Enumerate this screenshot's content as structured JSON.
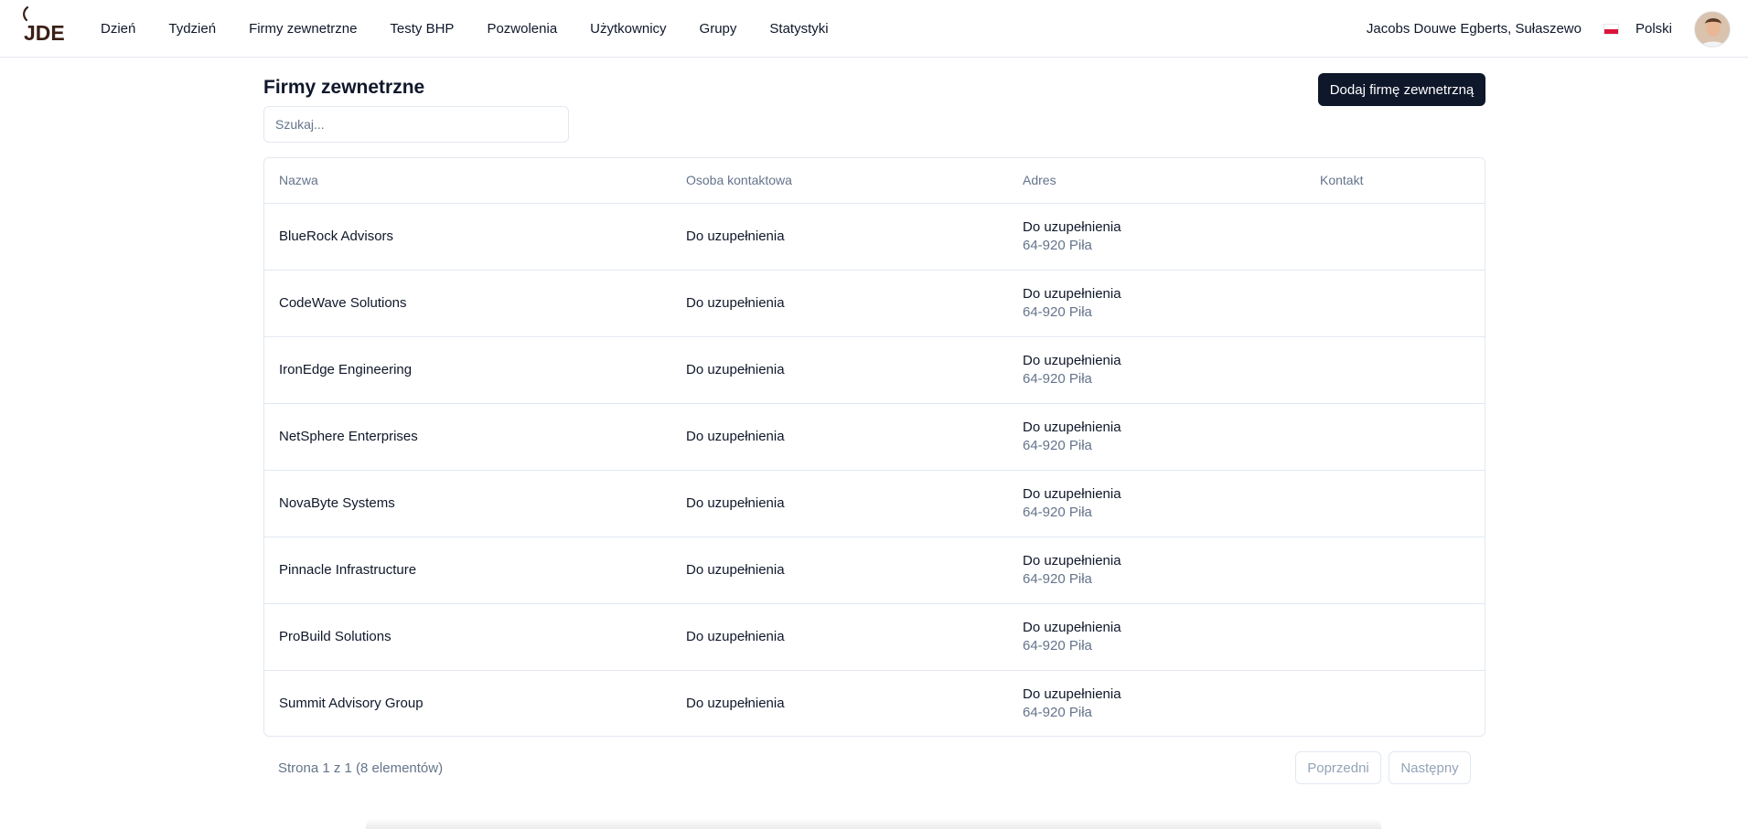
{
  "nav": {
    "logo_text": "JDE",
    "items": [
      {
        "label": "Dzień"
      },
      {
        "label": "Tydzień"
      },
      {
        "label": "Firmy zewnetrzne"
      },
      {
        "label": "Testy BHP"
      },
      {
        "label": "Pozwolenia"
      },
      {
        "label": "Użytkownicy"
      },
      {
        "label": "Grupy"
      },
      {
        "label": "Statystyki"
      }
    ],
    "company": "Jacobs Douwe Egberts, Sułaszewo",
    "language": "Polski",
    "flag_icon": "poland-flag-icon",
    "avatar_icon": "user-avatar"
  },
  "page": {
    "title": "Firmy zewnetrzne",
    "add_button": "Dodaj firmę zewnetrzną",
    "search_placeholder": "Szukaj..."
  },
  "table": {
    "columns": [
      "Nazwa",
      "Osoba kontaktowa",
      "Adres",
      "Kontakt"
    ],
    "rows": [
      {
        "name": "BlueRock Advisors",
        "contact_person": "Do uzupełnienia",
        "address_line1": "Do uzupełnienia",
        "address_line2": "64-920 Piła",
        "contact": ""
      },
      {
        "name": "CodeWave Solutions",
        "contact_person": "Do uzupełnienia",
        "address_line1": "Do uzupełnienia",
        "address_line2": "64-920 Piła",
        "contact": ""
      },
      {
        "name": "IronEdge Engineering",
        "contact_person": "Do uzupełnienia",
        "address_line1": "Do uzupełnienia",
        "address_line2": "64-920 Piła",
        "contact": ""
      },
      {
        "name": "NetSphere Enterprises",
        "contact_person": "Do uzupełnienia",
        "address_line1": "Do uzupełnienia",
        "address_line2": "64-920 Piła",
        "contact": ""
      },
      {
        "name": "NovaByte Systems",
        "contact_person": "Do uzupełnienia",
        "address_line1": "Do uzupełnienia",
        "address_line2": "64-920 Piła",
        "contact": ""
      },
      {
        "name": "Pinnacle Infrastructure",
        "contact_person": "Do uzupełnienia",
        "address_line1": "Do uzupełnienia",
        "address_line2": "64-920 Piła",
        "contact": ""
      },
      {
        "name": "ProBuild Solutions",
        "contact_person": "Do uzupełnienia",
        "address_line1": "Do uzupełnienia",
        "address_line2": "64-920 Piła",
        "contact": ""
      },
      {
        "name": "Summit Advisory Group",
        "contact_person": "Do uzupełnienia",
        "address_line1": "Do uzupełnienia",
        "address_line2": "64-920 Piła",
        "contact": ""
      }
    ]
  },
  "pagination": {
    "info": "Strona 1 z 1 (8 elementów)",
    "prev_label": "Poprzedni",
    "next_label": "Następny"
  },
  "colors": {
    "brand": "#3b1f14",
    "primary_button": "#0f172a",
    "muted_text": "#64748b",
    "border": "#e2e8f0"
  }
}
